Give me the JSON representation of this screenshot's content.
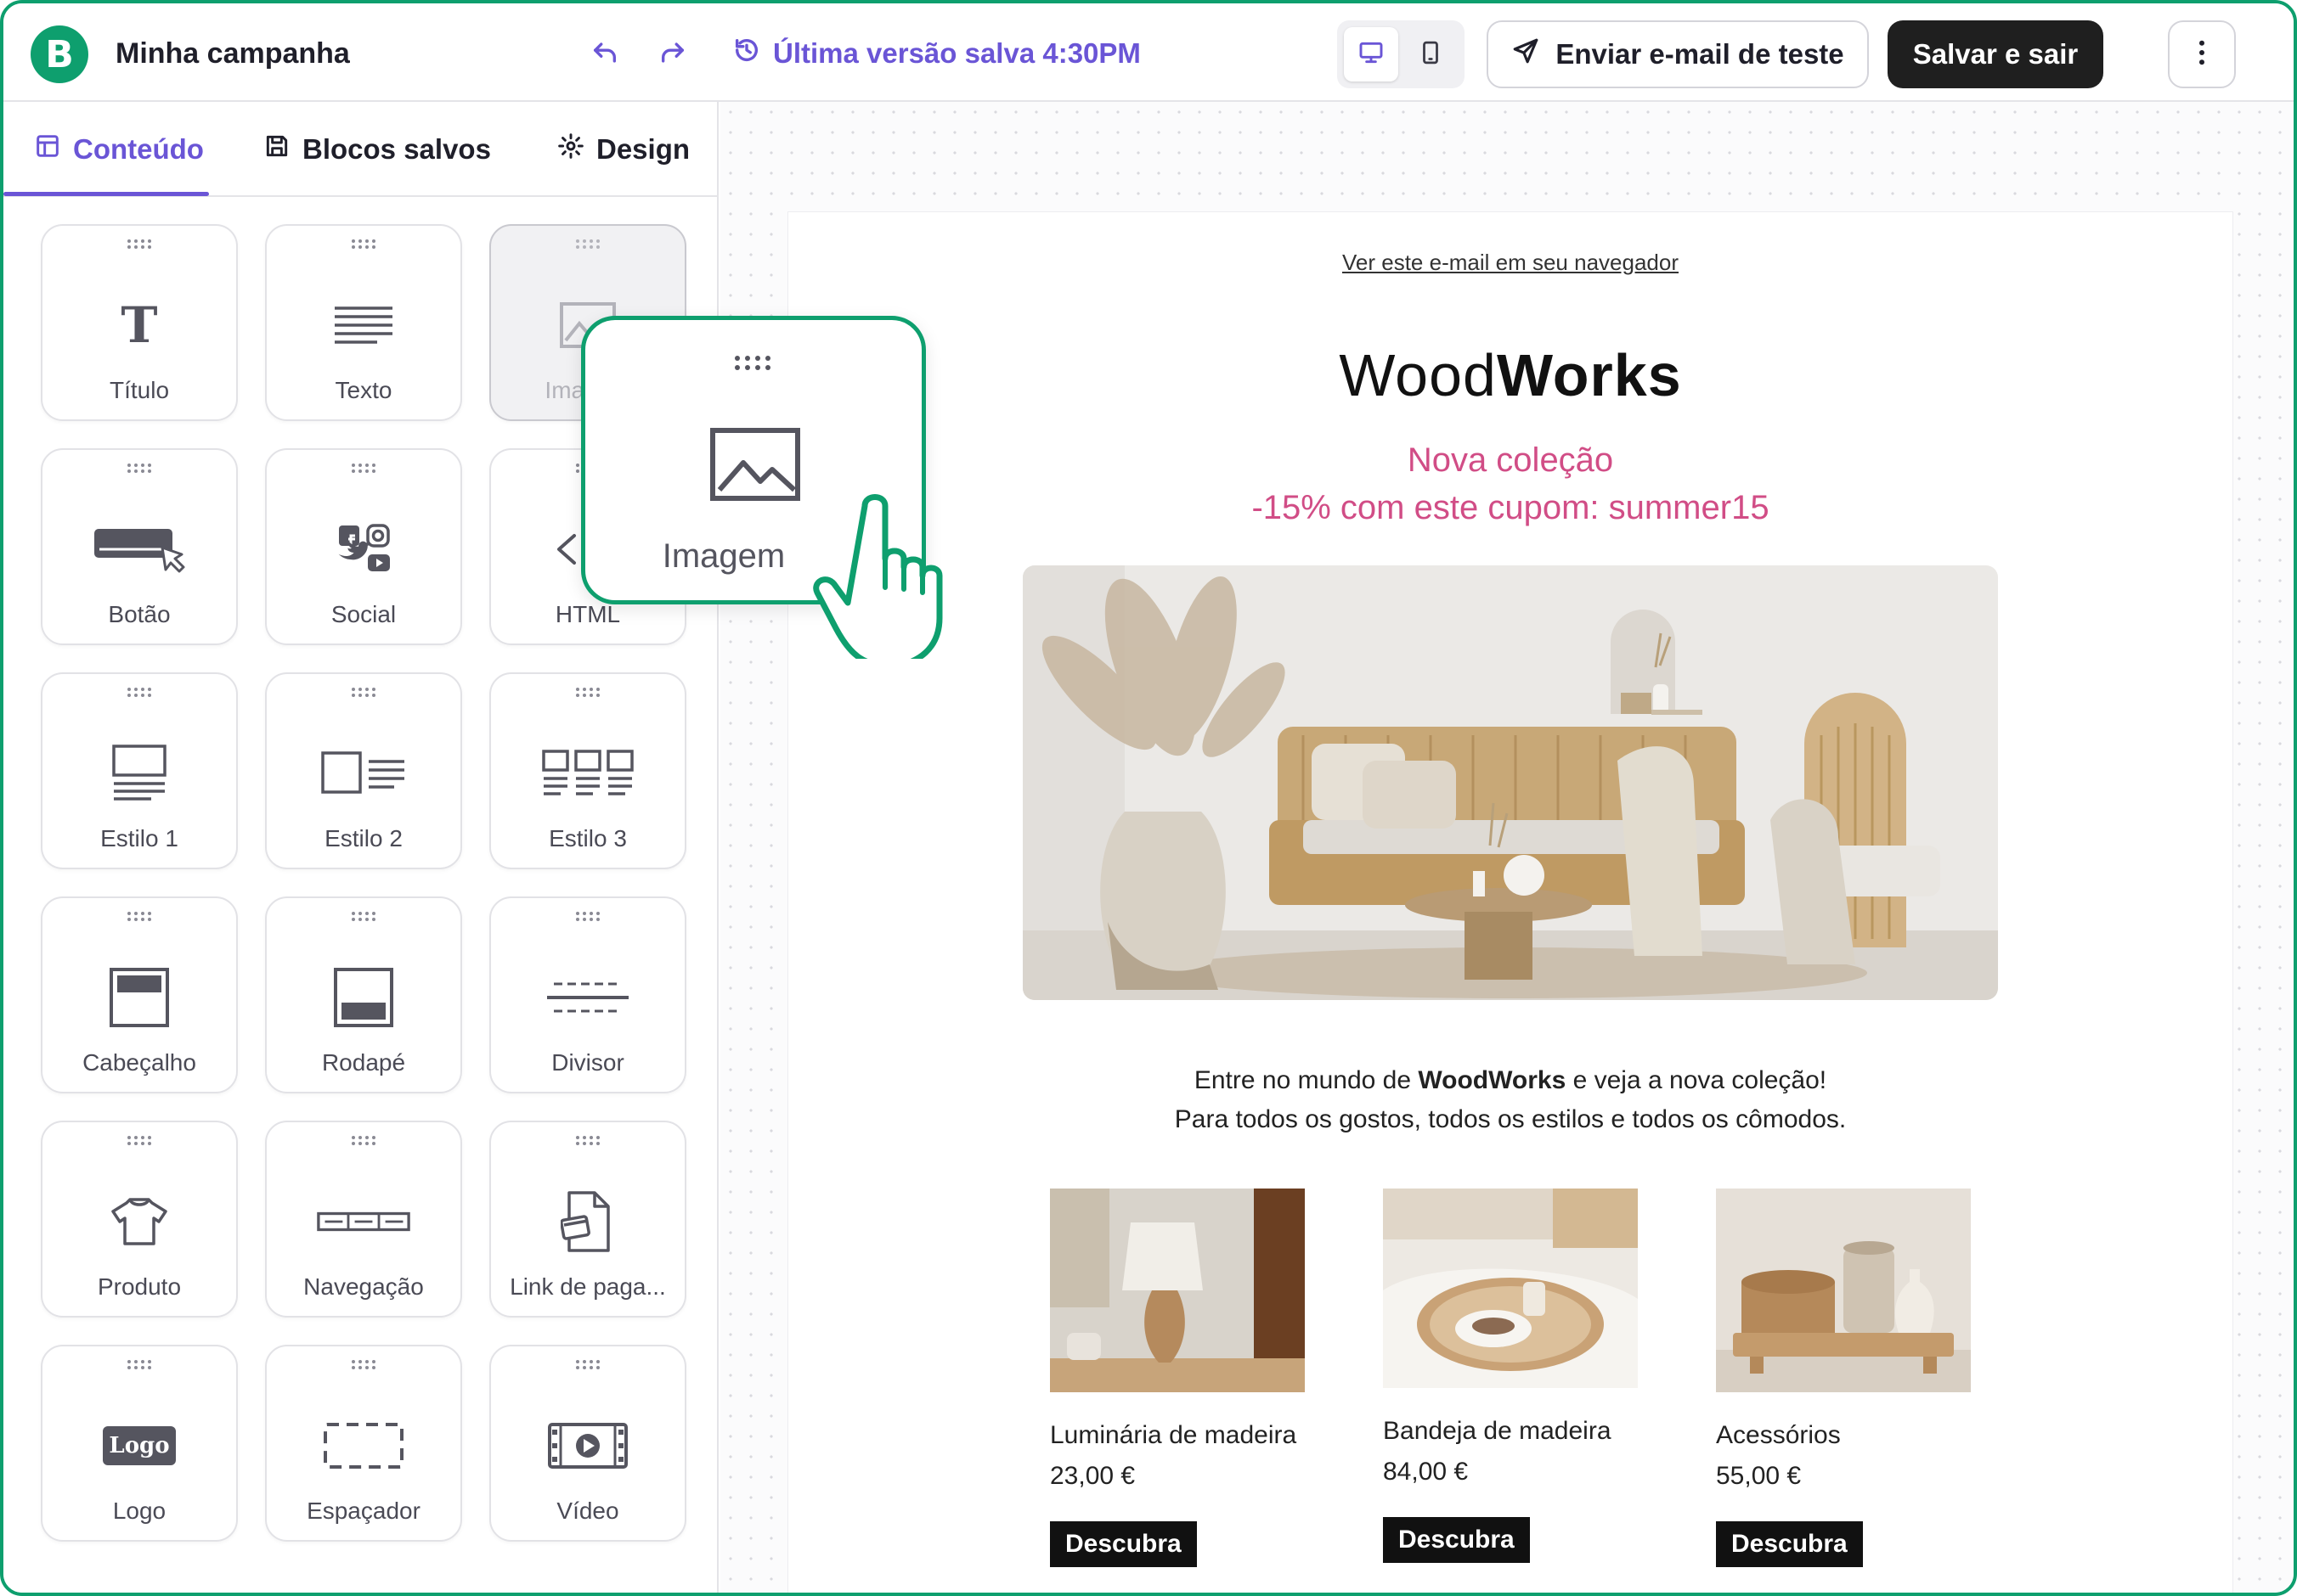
{
  "header": {
    "logo_letter": "B",
    "campaign_name": "Minha campanha",
    "version_text": "Última versão salva 4:30PM",
    "send_test_label": "Enviar e-mail de teste",
    "save_exit_label": "Salvar e sair",
    "accent_color": "#6a55d6",
    "brand_color": "#0e9f6e"
  },
  "sidebar": {
    "tabs": [
      {
        "label": "Conteúdo",
        "icon": "layout-icon",
        "active": true
      },
      {
        "label": "Blocos salvos",
        "icon": "save-icon",
        "active": false
      },
      {
        "label": "Design",
        "icon": "gear-icon",
        "active": false
      }
    ],
    "blocks": [
      {
        "label": "Título",
        "icon": "title-icon"
      },
      {
        "label": "Texto",
        "icon": "text-icon"
      },
      {
        "label": "Imagem",
        "icon": "image-icon",
        "dragging": true
      },
      {
        "label": "Botão",
        "icon": "button-icon"
      },
      {
        "label": "Social",
        "icon": "social-icon"
      },
      {
        "label": "HTML",
        "icon": "code-icon"
      },
      {
        "label": "Estilo 1",
        "icon": "style1-icon"
      },
      {
        "label": "Estilo 2",
        "icon": "style2-icon"
      },
      {
        "label": "Estilo 3",
        "icon": "style3-icon"
      },
      {
        "label": "Cabeçalho",
        "icon": "header-block-icon"
      },
      {
        "label": "Rodapé",
        "icon": "footer-block-icon"
      },
      {
        "label": "Divisor",
        "icon": "divider-icon"
      },
      {
        "label": "Produto",
        "icon": "tshirt-icon"
      },
      {
        "label": "Navegação",
        "icon": "navigation-icon"
      },
      {
        "label": "Link de paga...",
        "icon": "payment-link-icon"
      },
      {
        "label": "Logo",
        "icon": "logo-icon"
      },
      {
        "label": "Espaçador",
        "icon": "spacer-icon"
      },
      {
        "label": "Vídeo",
        "icon": "video-icon"
      }
    ],
    "drag_preview_label": "Imagem",
    "logo_tile_text": "Logo"
  },
  "email": {
    "view_in_browser": "Ver este e-mail em seu navegador",
    "brand_light": "Wood",
    "brand_bold": "Works",
    "promo_line1": "Nova coleção",
    "promo_line2": "-15% com este cupom: summer15",
    "promo_color": "#d14d86",
    "intro_prefix": "Entre no mundo de ",
    "intro_bold": "WoodWorks",
    "intro_suffix": " e veja a nova coleção!",
    "intro_line2": "Para todos os gostos, todos os estilos e todos os cômodos.",
    "products": [
      {
        "name": "Luminária de madeira",
        "price": "23,00 €",
        "cta": "Descubra"
      },
      {
        "name": "Bandeja de madeira",
        "price": "84,00 €",
        "cta": "Descubra"
      },
      {
        "name": "Acessórios",
        "price": "55,00 €",
        "cta": "Descubra"
      }
    ]
  }
}
